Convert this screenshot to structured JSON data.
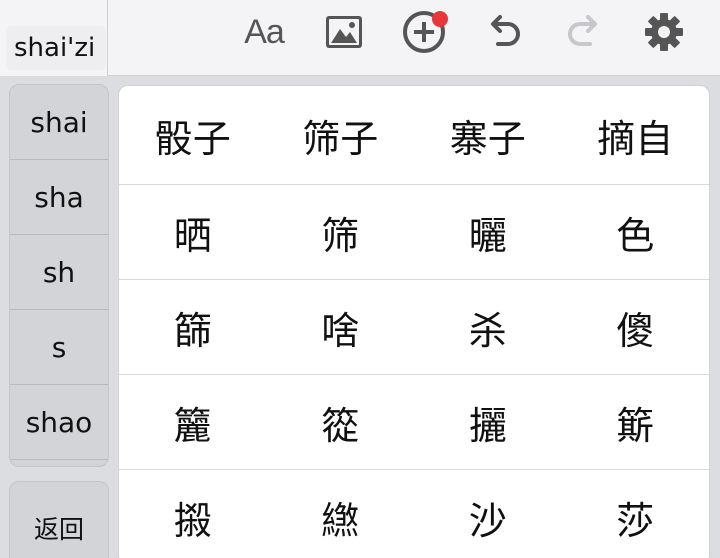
{
  "composition": {
    "partial_char": "ˇˇ",
    "pinyin": "shai'zi"
  },
  "toolbar": {
    "icons": [
      "font-style-icon",
      "image-icon",
      "add-circle-icon",
      "undo-icon",
      "redo-icon",
      "gear-icon"
    ],
    "font_label": "Aa",
    "colors": {
      "icon": "#555555",
      "icon_disabled": "#c7c7cb",
      "badge": "#e8373b"
    }
  },
  "pinyin_options": [
    "shai",
    "sha",
    "sh",
    "s",
    "shao"
  ],
  "back_label": "返回",
  "candidates": [
    [
      "骰子",
      "筛子",
      "寨子",
      "摘自"
    ],
    [
      "晒",
      "筛",
      "曬",
      "色"
    ],
    [
      "篩",
      "啥",
      "杀",
      "傻"
    ],
    [
      "籭",
      "篵",
      "攦",
      "簛"
    ],
    [
      "摋",
      "繺",
      "沙",
      "莎"
    ]
  ]
}
